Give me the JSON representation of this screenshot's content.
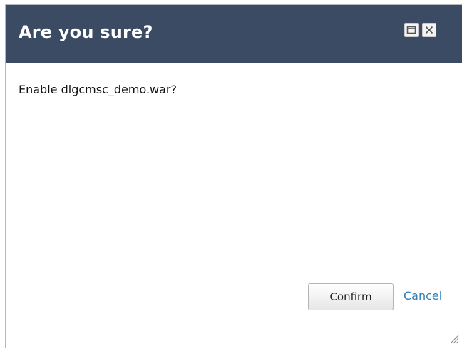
{
  "dialog": {
    "title": "Are you sure?",
    "message": "Enable dlgcmsc_demo.war?",
    "confirm_label": "Confirm",
    "cancel_label": "Cancel"
  },
  "icons": {
    "maximize": "maximize-icon",
    "close": "close-icon",
    "resize": "resize-grip-icon"
  },
  "colors": {
    "titlebar": "#3b4b63",
    "link": "#2e7fb8"
  }
}
